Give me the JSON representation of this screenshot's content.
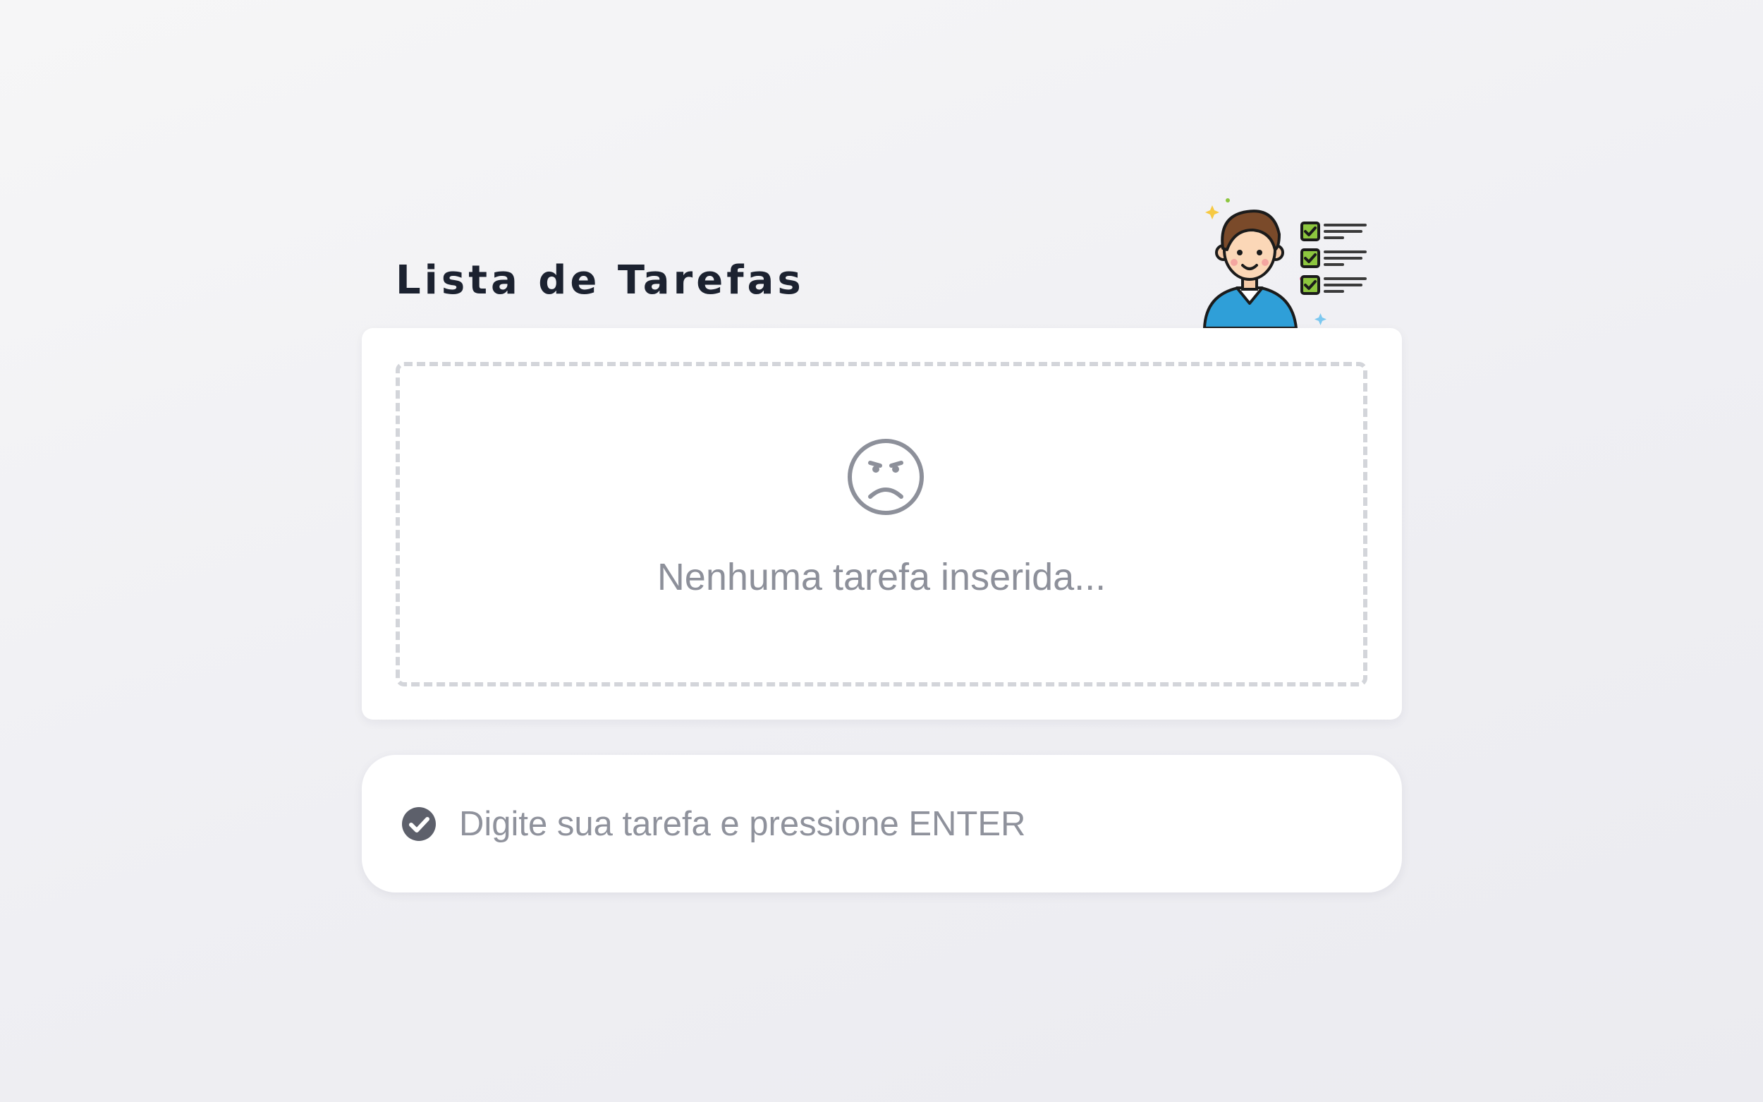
{
  "header": {
    "title": "Lista de Tarefas",
    "illustration_icon": "person-with-checklist-icon"
  },
  "task_list": {
    "empty_icon": "sad-face-icon",
    "empty_message": "Nenhuma tarefa inserida..."
  },
  "task_input": {
    "icon": "check-circle-icon",
    "value": "",
    "placeholder": "Digite sua tarefa e pressione ENTER"
  },
  "colors": {
    "title": "#1c2230",
    "muted_text": "#8d909a",
    "dashed_border": "#d3d5da",
    "check_icon": "#5d606b",
    "checklist_green": "#8dc63f",
    "shirt_blue": "#2f9fd8",
    "hair_brown": "#7a4a2a"
  }
}
